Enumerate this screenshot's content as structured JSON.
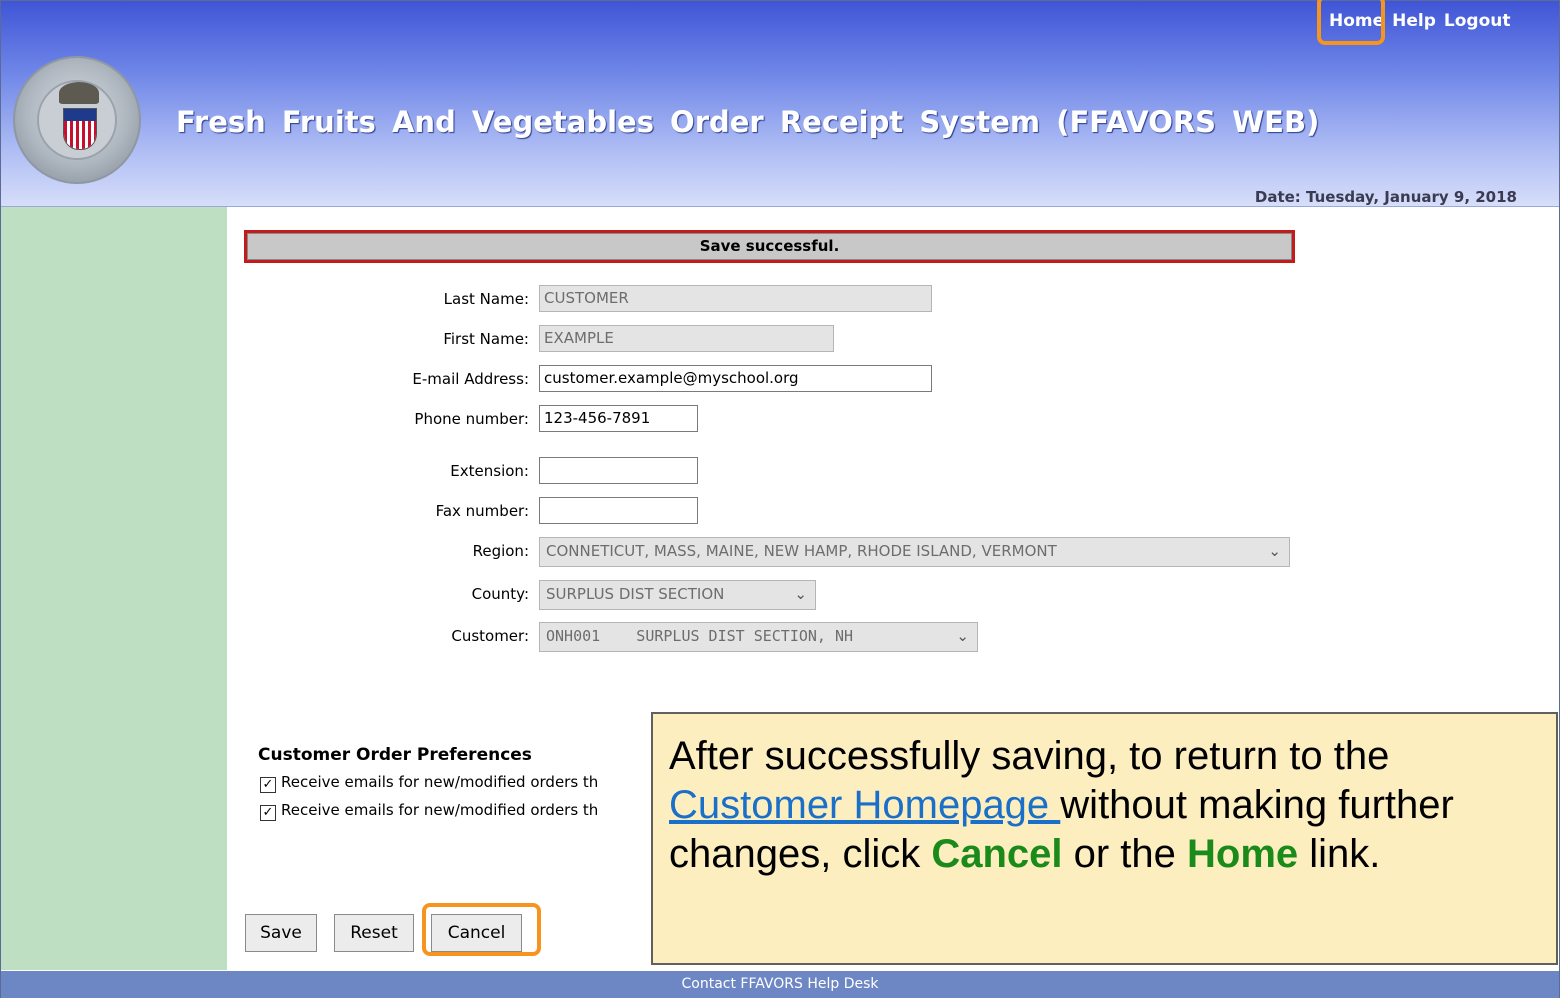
{
  "header": {
    "title": "Fresh  Fruits  And  Vegetables  Order  Receipt  System (FFAVORS WEB)",
    "nav": {
      "home": "Home",
      "help": "Help",
      "logout": "Logout"
    },
    "date": "Date: Tuesday, January 9, 2018"
  },
  "message": "Save successful.",
  "form": {
    "last_name": {
      "label": "Last Name:",
      "value": "CUSTOMER"
    },
    "first_name": {
      "label": "First Name:",
      "value": "EXAMPLE"
    },
    "email": {
      "label": "E-mail Address:",
      "value": "customer.example@myschool.org"
    },
    "phone": {
      "label": "Phone number:",
      "value": "123-456-7891"
    },
    "extension": {
      "label": "Extension:",
      "value": ""
    },
    "fax": {
      "label": "Fax number:",
      "value": ""
    },
    "region": {
      "label": "Region:",
      "value": "CONNETICUT, MASS, MAINE, NEW HAMP, RHODE ISLAND, VERMONT"
    },
    "county": {
      "label": "County:",
      "value": "SURPLUS DIST SECTION"
    },
    "customer": {
      "label": "Customer:",
      "value": "ONH001    SURPLUS DIST SECTION, NH"
    }
  },
  "preferences": {
    "title": "Customer Order Preferences",
    "items": [
      {
        "label": "Receive emails for new/modified orders th",
        "checked": true
      },
      {
        "label": "Receive emails for new/modified orders th",
        "checked": true
      }
    ]
  },
  "buttons": {
    "save": "Save",
    "reset": "Reset",
    "cancel": "Cancel"
  },
  "callout": {
    "part1": "After successfully saving, to return to the ",
    "link": "Customer Homepage ",
    "part2": "without making further changes, click ",
    "cancel": "Cancel",
    "part3": " or the ",
    "home": "Home",
    "part4": " link."
  },
  "footer": "Contact FFAVORS Help Desk",
  "colors": {
    "highlight": "#f7941d",
    "sidebar": "#bfdfc3",
    "callout_bg": "#fdeec0"
  }
}
